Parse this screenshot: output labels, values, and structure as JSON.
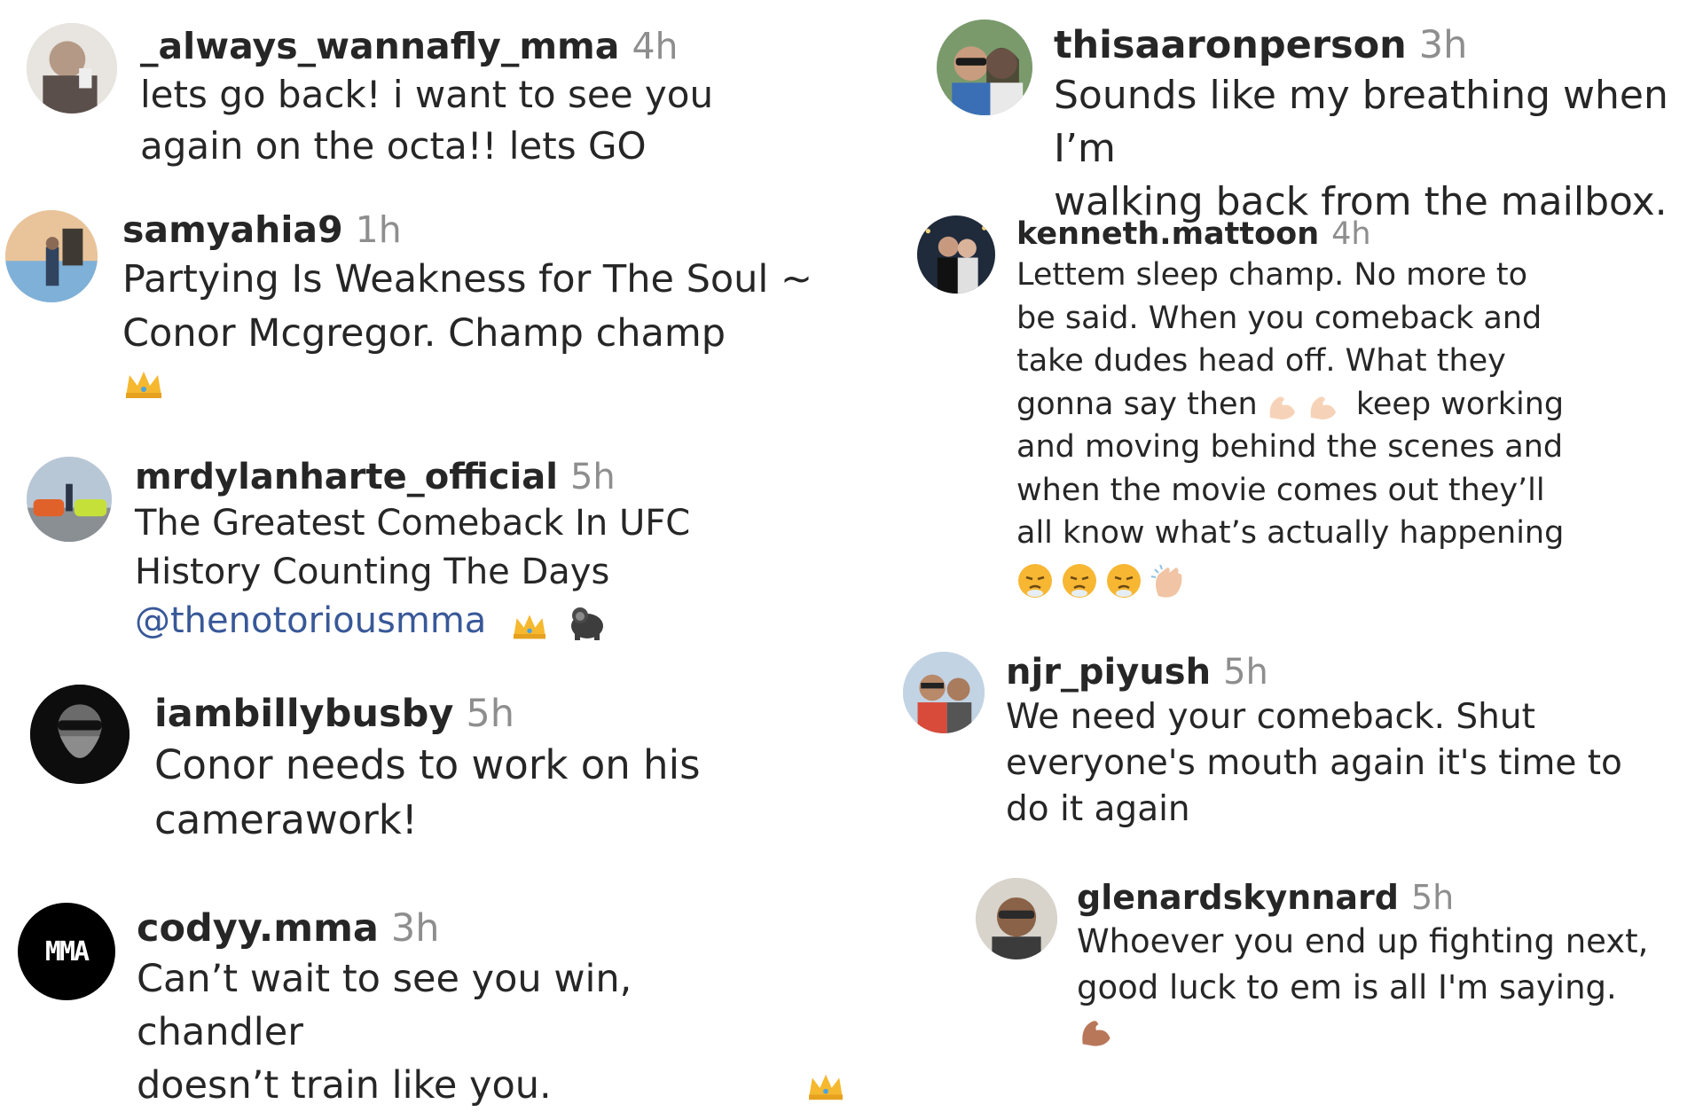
{
  "comments_left": [
    {
      "username": "_always_wannafly_mma",
      "time": "4h",
      "text": "lets go back! i want to see you\nagain on the octa!! lets GO"
    },
    {
      "username": "samyahia9",
      "time": "1h",
      "text": "Partying Is Weakness for The Soul ~\nConor Mcgregor. Champ champ",
      "emoji": [
        "crown-icon"
      ]
    },
    {
      "username": "mrdylanharte_official",
      "time": "5h",
      "text": "The Greatest Comeback In UFC\nHistory Counting The Days",
      "mention": "@thenotoriousmma",
      "emoji": [
        "crown-icon",
        "gorilla-icon"
      ]
    },
    {
      "username": "iambillybusby",
      "time": "5h",
      "text": "Conor needs to work on his\ncamerawork!"
    },
    {
      "username": "codyy.mma",
      "time": "3h",
      "text": "Can’t wait to see you win, chandler\ndoesn’t train like you.",
      "avatar_text": "MMA",
      "emoji": [
        "crown-icon"
      ]
    }
  ],
  "comments_right": [
    {
      "username": "thisaaronperson",
      "time": "3h",
      "text": "Sounds like my breathing when I’m\nwalking back from the mailbox."
    },
    {
      "username": "kenneth.mattoon",
      "time": "4h",
      "text": "Lettem sleep champ. No more to\nbe said. When you comeback and\ntake dudes head off. What they\ngonna say then",
      "text_after": "keep working\nand moving behind the scenes and\nwhen the movie comes out they’ll\nall know what’s actually happening",
      "emoji": [
        "flexed-biceps-icon",
        "flexed-biceps-icon"
      ],
      "emoji_end": [
        "exhale-face-icon",
        "exhale-face-icon",
        "exhale-face-icon",
        "clapping-hand-icon"
      ]
    },
    {
      "username": "njr_piyush",
      "time": "5h",
      "text": "We need your comeback. Shut\neveryone's mouth again it's time to\ndo it again"
    },
    {
      "username": "glenardskynnard",
      "time": "5h",
      "text": "Whoever you end up fighting next,\ngood luck to em is all I'm saying.",
      "emoji": [
        "flexed-biceps-icon"
      ]
    }
  ],
  "colors": {
    "text": "#262626",
    "muted": "#8e8e8e",
    "link": "#385898"
  }
}
